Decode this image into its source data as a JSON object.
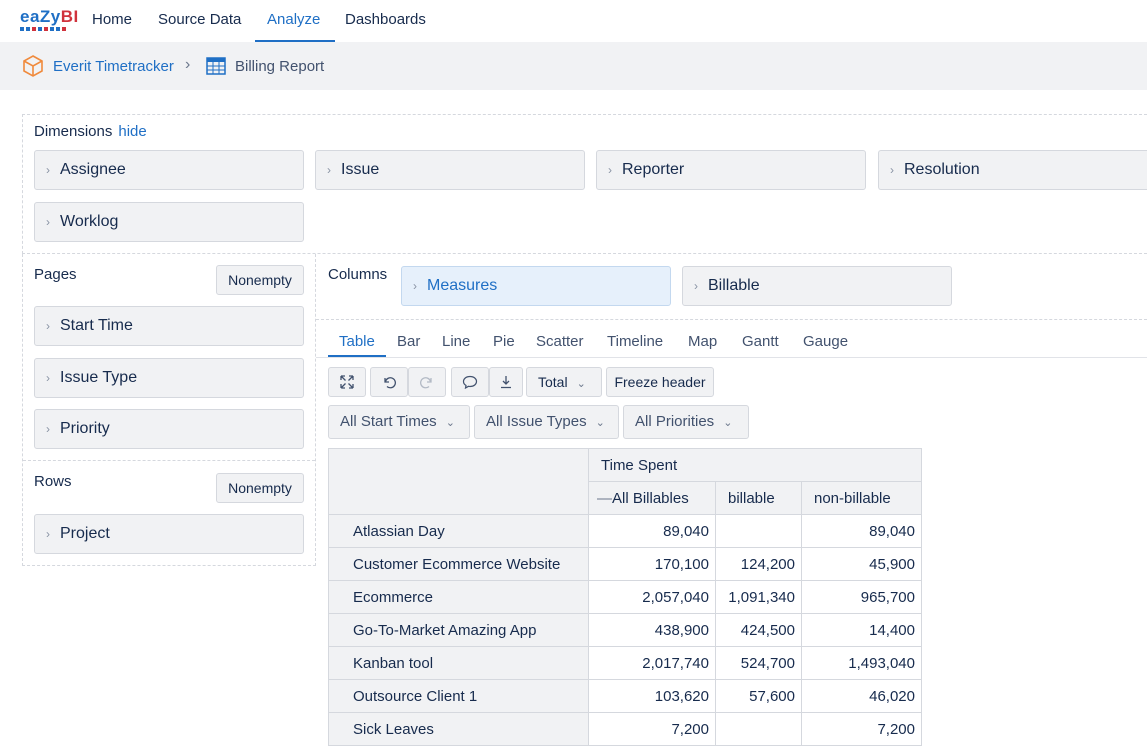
{
  "nav": {
    "logo_text_a": "eaZy",
    "logo_text_b": "BI",
    "items": [
      "Home",
      "Source Data",
      "Analyze",
      "Dashboards"
    ],
    "active": "Analyze",
    "accent_color": "#1f6fc5"
  },
  "breadcrumb": {
    "cube_icon": "cube-icon",
    "cube": "Everit Timetracker",
    "report_icon": "table-grid-icon",
    "report": "Billing Report"
  },
  "dimensions": {
    "label": "Dimensions",
    "hide": "hide",
    "items": [
      "Assignee",
      "Issue",
      "Reporter",
      "Resolution",
      "Worklog"
    ]
  },
  "pages": {
    "label": "Pages",
    "nonempty": "Nonempty",
    "items": [
      "Start Time",
      "Issue Type",
      "Priority"
    ]
  },
  "rows_section": {
    "label": "Rows",
    "nonempty": "Nonempty",
    "items": [
      "Project"
    ]
  },
  "columns": {
    "label": "Columns",
    "items": [
      "Measures",
      "Billable"
    ]
  },
  "view_tabs": [
    "Table",
    "Bar",
    "Line",
    "Pie",
    "Scatter",
    "Timeline",
    "Map",
    "Gantt",
    "Gauge"
  ],
  "toolbar": {
    "fullscreen_icon": "expand-icon",
    "undo_icon": "undo-icon",
    "redo_icon": "redo-icon",
    "comment_icon": "comment-icon",
    "export_icon": "download-icon",
    "total": "Total",
    "freeze": "Freeze header"
  },
  "filters": [
    "All Start Times",
    "All Issue Types",
    "All Priorities"
  ],
  "report_table": {
    "measure": "Time Spent",
    "collapse_marker": "—",
    "column_headers": [
      "All Billables",
      "billable",
      "non-billable"
    ],
    "rows": [
      {
        "project": "Atlassian Day",
        "all": "89,040",
        "billable": "",
        "non_billable": "89,040"
      },
      {
        "project": "Customer Ecommerce Website",
        "all": "170,100",
        "billable": "124,200",
        "non_billable": "45,900"
      },
      {
        "project": "Ecommerce",
        "all": "2,057,040",
        "billable": "1,091,340",
        "non_billable": "965,700"
      },
      {
        "project": "Go-To-Market Amazing App",
        "all": "438,900",
        "billable": "424,500",
        "non_billable": "14,400"
      },
      {
        "project": "Kanban tool",
        "all": "2,017,740",
        "billable": "524,700",
        "non_billable": "1,493,040"
      },
      {
        "project": "Outsource Client 1",
        "all": "103,620",
        "billable": "57,600",
        "non_billable": "46,020"
      },
      {
        "project": "Sick Leaves",
        "all": "7,200",
        "billable": "",
        "non_billable": "7,200"
      }
    ]
  }
}
